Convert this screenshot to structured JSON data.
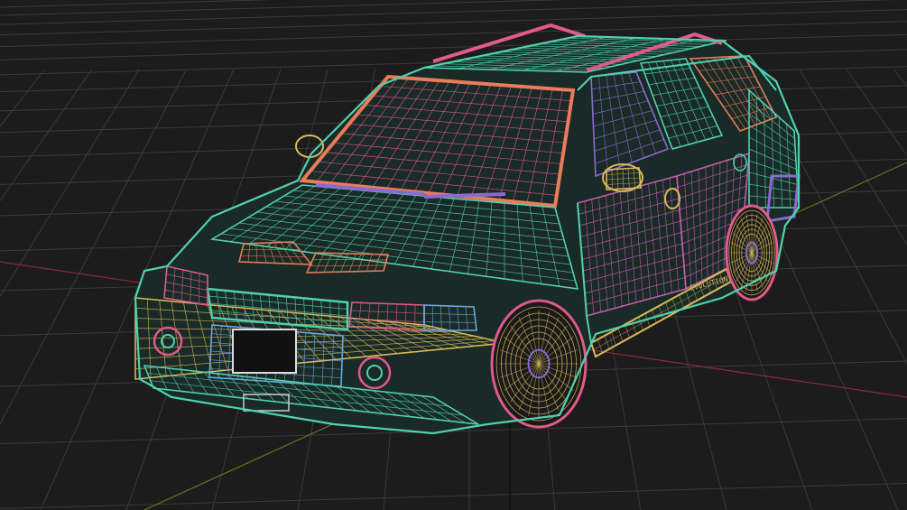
{
  "viewport": {
    "background": "#1c1c1c",
    "grid_color": "#3a3a3a",
    "x_axis_color": "#8a2a3a",
    "y_axis_color": "#5e7a22",
    "z_axis_color": "#2a2a2a"
  },
  "model": {
    "palette": {
      "teal": "#4fd1b0",
      "pink": "#e05a8a",
      "gold": "#d7b85a",
      "violet": "#8a6ad0",
      "salmon": "#e97c5a",
      "magenta": "#c25bb0",
      "blue": "#6aa8e0"
    },
    "side_stripe_text": "EVOLUTION"
  }
}
